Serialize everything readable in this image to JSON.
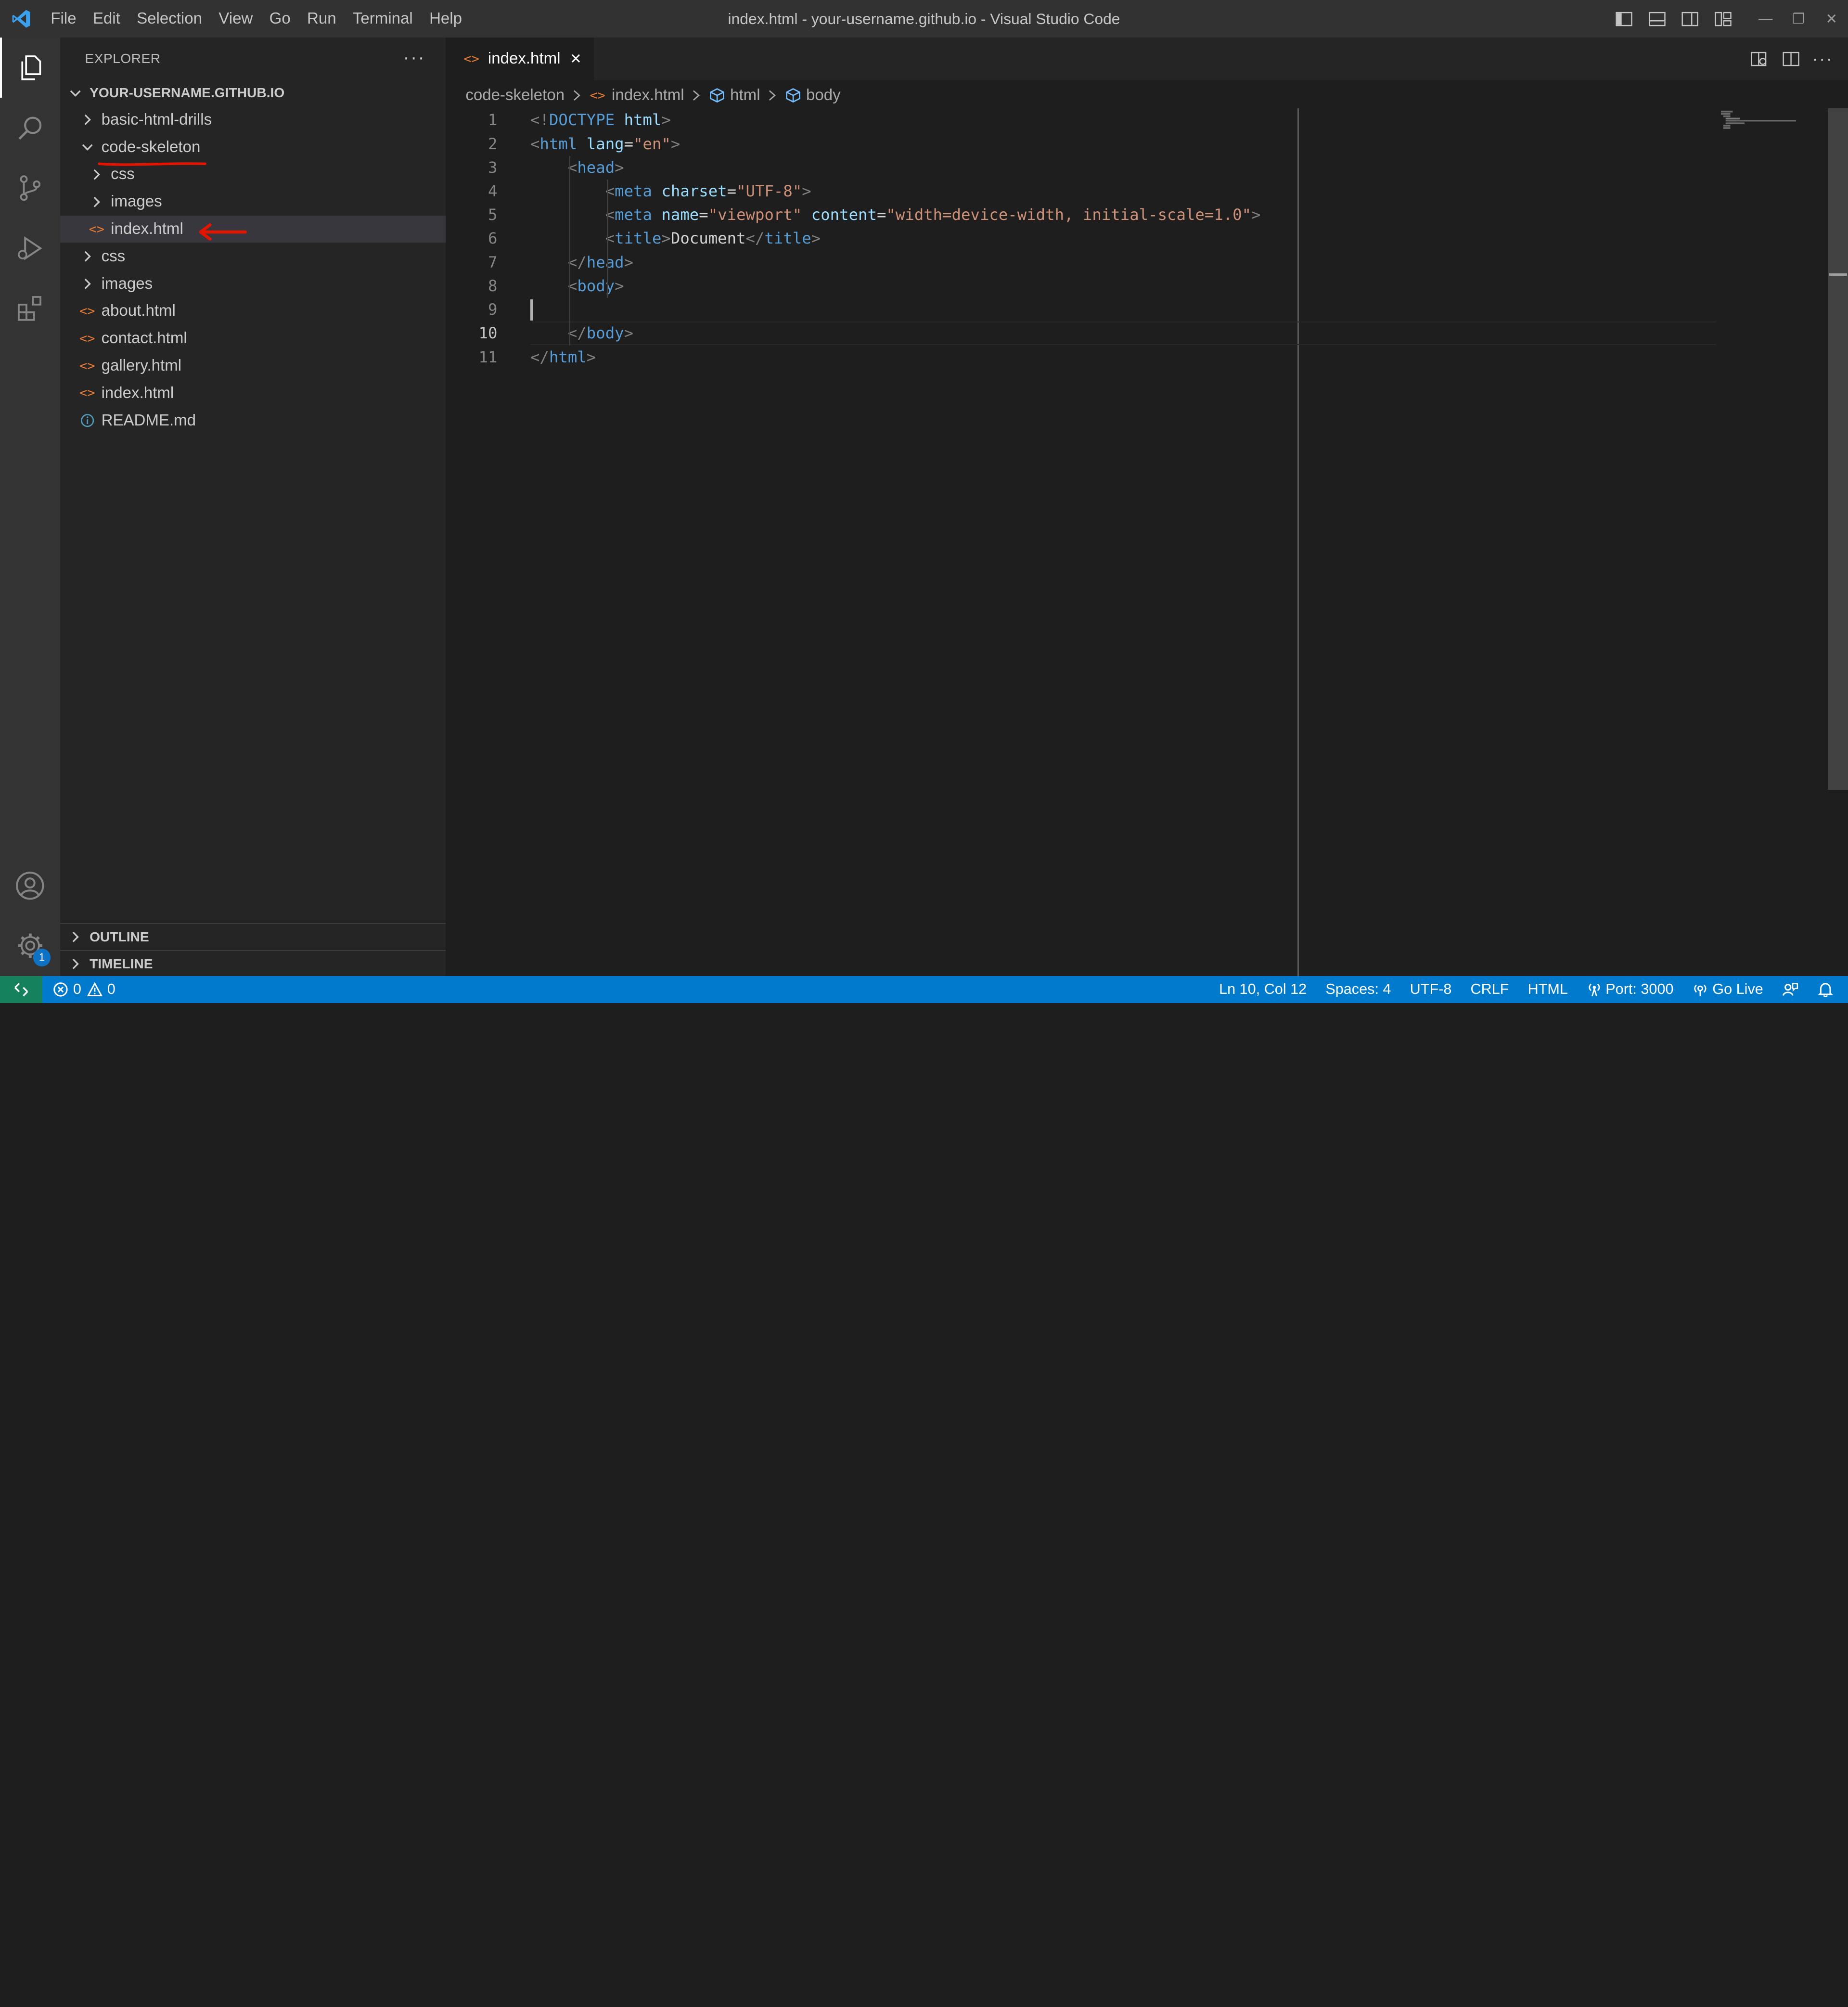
{
  "window": {
    "title": "index.html - your-username.github.io - Visual Studio Code"
  },
  "menu": [
    "File",
    "Edit",
    "Selection",
    "View",
    "Go",
    "Run",
    "Terminal",
    "Help"
  ],
  "sidebar": {
    "title": "EXPLORER",
    "more": "···",
    "root": "YOUR-USERNAME.GITHUB.IO",
    "tree": [
      {
        "label": "basic-html-drills",
        "kind": "folder-collapsed",
        "depth": 0
      },
      {
        "label": "code-skeleton",
        "kind": "folder-expanded",
        "depth": 0
      },
      {
        "label": "css",
        "kind": "folder-collapsed",
        "depth": 1
      },
      {
        "label": "images",
        "kind": "folder-collapsed",
        "depth": 1
      },
      {
        "label": "index.html",
        "kind": "html-file",
        "depth": 1,
        "selected": true
      },
      {
        "label": "css",
        "kind": "folder-collapsed",
        "depth": 0
      },
      {
        "label": "images",
        "kind": "folder-collapsed",
        "depth": 0
      },
      {
        "label": "about.html",
        "kind": "html-file",
        "depth": 0
      },
      {
        "label": "contact.html",
        "kind": "html-file",
        "depth": 0
      },
      {
        "label": "gallery.html",
        "kind": "html-file",
        "depth": 0
      },
      {
        "label": "index.html",
        "kind": "html-file",
        "depth": 0
      },
      {
        "label": "README.md",
        "kind": "info-file",
        "depth": 0
      }
    ],
    "outline": "OUTLINE",
    "timeline": "TIMELINE"
  },
  "activity": {
    "settings_badge": "1"
  },
  "tab": {
    "label": "index.html",
    "close": "✕"
  },
  "breadcrumb": [
    "code-skeleton",
    "index.html",
    "html",
    "body"
  ],
  "editor": {
    "current_line": 10,
    "lines": [
      [
        [
          "<!",
          "p"
        ],
        [
          "DOCTYPE",
          "k"
        ],
        [
          " ",
          "t"
        ],
        [
          "html",
          "a"
        ],
        [
          ">",
          "p"
        ]
      ],
      [
        [
          "<",
          "p"
        ],
        [
          "html",
          "k"
        ],
        [
          " ",
          "t"
        ],
        [
          "lang",
          "a"
        ],
        [
          "=",
          "t"
        ],
        [
          "\"en\"",
          "s"
        ],
        [
          ">",
          "p"
        ]
      ],
      [
        [
          "    ",
          "t"
        ],
        [
          "<",
          "p"
        ],
        [
          "head",
          "k"
        ],
        [
          ">",
          "p"
        ]
      ],
      [
        [
          "        ",
          "t"
        ],
        [
          "<",
          "p"
        ],
        [
          "meta",
          "k"
        ],
        [
          " ",
          "t"
        ],
        [
          "charset",
          "a"
        ],
        [
          "=",
          "t"
        ],
        [
          "\"UTF-8\"",
          "s"
        ],
        [
          ">",
          "p"
        ]
      ],
      [
        [
          "        ",
          "t"
        ],
        [
          "<",
          "p"
        ],
        [
          "meta",
          "k"
        ],
        [
          " ",
          "t"
        ],
        [
          "name",
          "a"
        ],
        [
          "=",
          "t"
        ],
        [
          "\"viewport\"",
          "s"
        ],
        [
          " ",
          "t"
        ],
        [
          "content",
          "a"
        ],
        [
          "=",
          "t"
        ],
        [
          "\"width=device-width, initial-scale=1.0\"",
          "s"
        ],
        [
          ">",
          "p"
        ]
      ],
      [
        [
          "        ",
          "t"
        ],
        [
          "<",
          "p"
        ],
        [
          "title",
          "k"
        ],
        [
          ">",
          "p"
        ],
        [
          "Document",
          "t"
        ],
        [
          "</",
          "p"
        ],
        [
          "title",
          "k"
        ],
        [
          ">",
          "p"
        ]
      ],
      [
        [
          "    ",
          "t"
        ],
        [
          "</",
          "p"
        ],
        [
          "head",
          "k"
        ],
        [
          ">",
          "p"
        ]
      ],
      [
        [
          "    ",
          "t"
        ],
        [
          "<",
          "p"
        ],
        [
          "body",
          "k"
        ],
        [
          ">",
          "p"
        ]
      ],
      [],
      [
        [
          "    ",
          "t"
        ],
        [
          "</",
          "p"
        ],
        [
          "body",
          "k"
        ],
        [
          ">",
          "p"
        ]
      ],
      [
        [
          "</",
          "p"
        ],
        [
          "html",
          "k"
        ],
        [
          ">",
          "p"
        ]
      ]
    ]
  },
  "status": {
    "errors": "0",
    "warnings": "0",
    "position": "Ln 10, Col 12",
    "spaces": "Spaces: 4",
    "encoding": "UTF-8",
    "eol": "CRLF",
    "language": "HTML",
    "port": "Port: 3000",
    "golive": "Go Live"
  },
  "colors": {
    "accent": "#007acc",
    "remote": "#16825d",
    "tag": "#569cd6",
    "attribute": "#9cdcfe",
    "string": "#ce9178",
    "punctuation": "#808080",
    "annotation": "#e51400"
  }
}
